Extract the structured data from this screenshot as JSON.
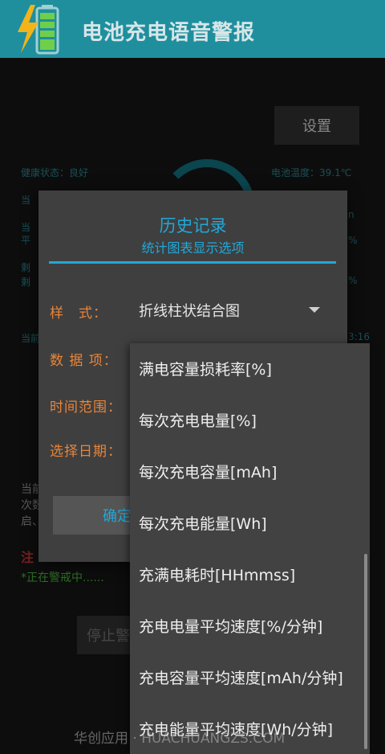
{
  "appbar": {
    "title": "电池充电语音警报",
    "icon": "battery-charging-icon"
  },
  "background": {
    "settings_label": "设置",
    "health": "健康状态：良好",
    "temperature": "电池温度：39.1℃",
    "fragments_left": [
      "当",
      "当",
      "平",
      "剩",
      "剩"
    ],
    "fragments_right": [
      "n",
      "%",
      "%"
    ],
    "row_left": "当前",
    "row_right": "3:16",
    "lower_left": [
      "当前",
      "次数",
      "启、"
    ],
    "warn": "注",
    "alert_text": "*正在警戒中......",
    "stop_label": "停止警"
  },
  "dialog": {
    "title": "历史记录",
    "subtitle": "统计图表显示选项",
    "style_label": "样　式：",
    "style_value": "折线柱状结合图",
    "data_label": "数 据 项：",
    "range_label": "时间范围：",
    "date_label": "选择日期：",
    "confirm_label": "确定"
  },
  "dropdown": {
    "options": [
      "满电容量损耗率[%]",
      "每次充电电量[%]",
      "每次充电容量[mAh]",
      "每次充电能量[Wh]",
      "充满电耗时[HHmmss]",
      "充电电量平均速度[%/分钟]",
      "充电容量平均速度[mAh/分钟]",
      "充电能量平均速度[Wh/分钟]"
    ]
  },
  "watermark": "华创应用 · HUACHUANGZS.COM",
  "colors": {
    "accent": "#21a8d8",
    "label_orange": "#e8853a",
    "appbar": "#1f8f9e",
    "alert_green": "#46a838"
  }
}
